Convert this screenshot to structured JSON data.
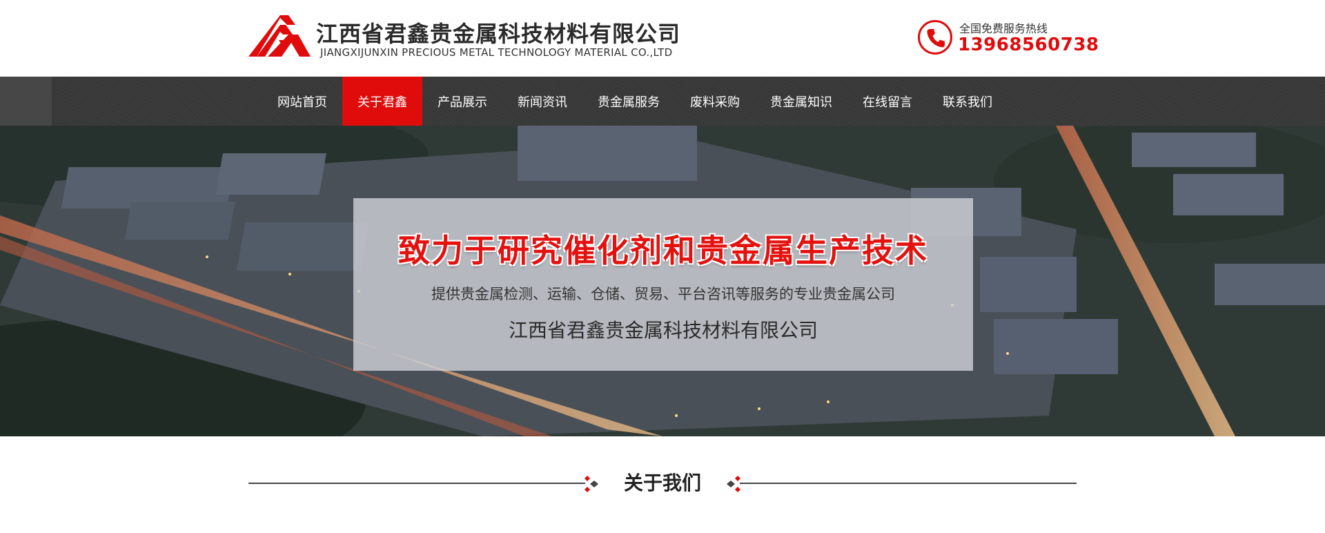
{
  "header": {
    "company_name": "江西省君鑫贵金属科技材料有限公司",
    "company_name_en": "JIANGXIJUNXIN PRECIOUS METAL TECHNOLOGY MATERIAL CO.,LTD",
    "hotline_label": "全国免费服务热线",
    "hotline_number": "13968560738",
    "logo_icon": "logo-mountain-icon",
    "phone_icon": "phone-icon"
  },
  "nav": {
    "items": [
      {
        "label": "网站首页",
        "active": false
      },
      {
        "label": "关于君鑫",
        "active": true
      },
      {
        "label": "产品展示",
        "active": false
      },
      {
        "label": "新闻资讯",
        "active": false
      },
      {
        "label": "贵金属服务",
        "active": false
      },
      {
        "label": "废料采购",
        "active": false
      },
      {
        "label": "贵金属知识",
        "active": false
      },
      {
        "label": "在线留言",
        "active": false
      },
      {
        "label": "联系我们",
        "active": false
      }
    ]
  },
  "banner": {
    "headline": "致力于研究催化剂和贵金属生产技术",
    "subtitle": "提供贵金属检测、运输、仓储、贸易、平台咨讯等服务的专业贵金属公司",
    "company": "江西省君鑫贵金属科技材料有限公司"
  },
  "section": {
    "title": "关于我们"
  },
  "colors": {
    "accent": "#e00c0c",
    "nav_bg": "#3a3a3a",
    "text_dark": "#2b2b2b"
  }
}
